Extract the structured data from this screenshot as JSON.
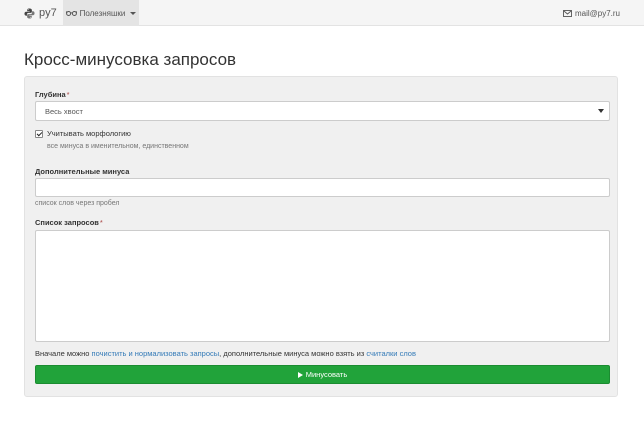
{
  "navbar": {
    "brand": "py7",
    "dropdown_label": "Полезняшки",
    "user_email": "mail@py7.ru"
  },
  "page": {
    "title": "Кросс-минусовка запросов"
  },
  "form": {
    "depth_label": "Глубина",
    "depth_value": "Весь хвост",
    "required_mark": "*",
    "morphology_label": "Учитывать морфологию",
    "morphology_checked": true,
    "morphology_help": "все минуса в именительном, единственном",
    "extra_minus_label": "Дополнительные минуса",
    "extra_minus_value": "",
    "extra_minus_help": "список слов через пробел",
    "queries_label": "Список запросов",
    "queries_value": "",
    "footnote_prefix": "Вначале можно ",
    "footnote_link1": "почистить и нормализовать запросы",
    "footnote_middle": ", дополнительные минуса можно взять из ",
    "footnote_link2": "считалки слов",
    "submit_label": "Минусовать"
  },
  "icons": {
    "brand_logo": "python-logo-icon",
    "dropdown_icon": "glasses-icon",
    "user_icon": "envelope-icon",
    "submit_icon": "play-icon"
  },
  "colors": {
    "submit_bg": "#21a33a",
    "link": "#337ab7",
    "panel_bg": "#f0f0f0"
  }
}
